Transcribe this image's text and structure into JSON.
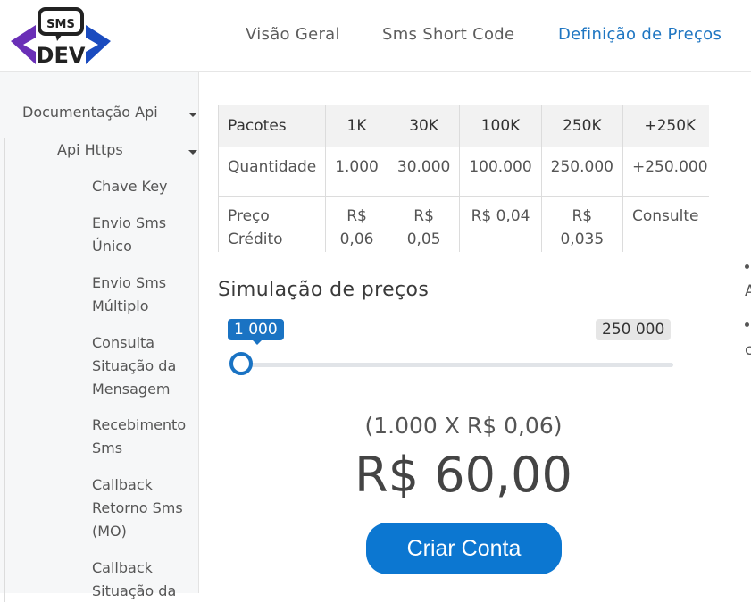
{
  "header": {
    "logo_top": "SMS",
    "logo_bottom": "DEV",
    "nav": [
      {
        "label": "Visão Geral"
      },
      {
        "label": "Sms Short Code"
      },
      {
        "label": "Definição de Preços",
        "active": true
      }
    ]
  },
  "sidebar": {
    "items": [
      {
        "label": "Documentação Api",
        "caret": true
      },
      {
        "label": "Api Https",
        "caret": true
      },
      {
        "label": "Chave Key"
      },
      {
        "label": "Envio Sms Único"
      },
      {
        "label": "Envio Sms Múltiplo"
      },
      {
        "label": "Consulta Situação da Mensagem"
      },
      {
        "label": "Recebimento Sms"
      },
      {
        "label": "Callback Retorno Sms (MO)"
      },
      {
        "label": "Callback Situação da"
      }
    ]
  },
  "pricing_table": {
    "headers": [
      "Pacotes",
      "1K",
      "30K",
      "100K",
      "250K",
      "+250K"
    ],
    "rows": [
      [
        "Quantidade",
        "1.000",
        "30.000",
        "100.000",
        "250.000",
        "+250.000"
      ],
      [
        "Preço Crédito",
        "R$ 0,06",
        "R$ 0,05",
        "R$ 0,04",
        "R$ 0,035",
        "Consulte"
      ]
    ]
  },
  "simulation": {
    "title": "Simulação de preços",
    "slider_min_label": "1 000",
    "slider_max_label": "250 000",
    "slider_value": 1000,
    "formula": "(1.000 X R$ 0,06)",
    "total": "R$ 60,00",
    "cta_label": "Criar Conta"
  },
  "right_fragments": [
    "A",
    "c"
  ],
  "colors": {
    "accent": "#1a73c3",
    "button": "#0c77d1",
    "logo_purple": "#6a2fb7",
    "logo_blue": "#1a4bbf"
  }
}
